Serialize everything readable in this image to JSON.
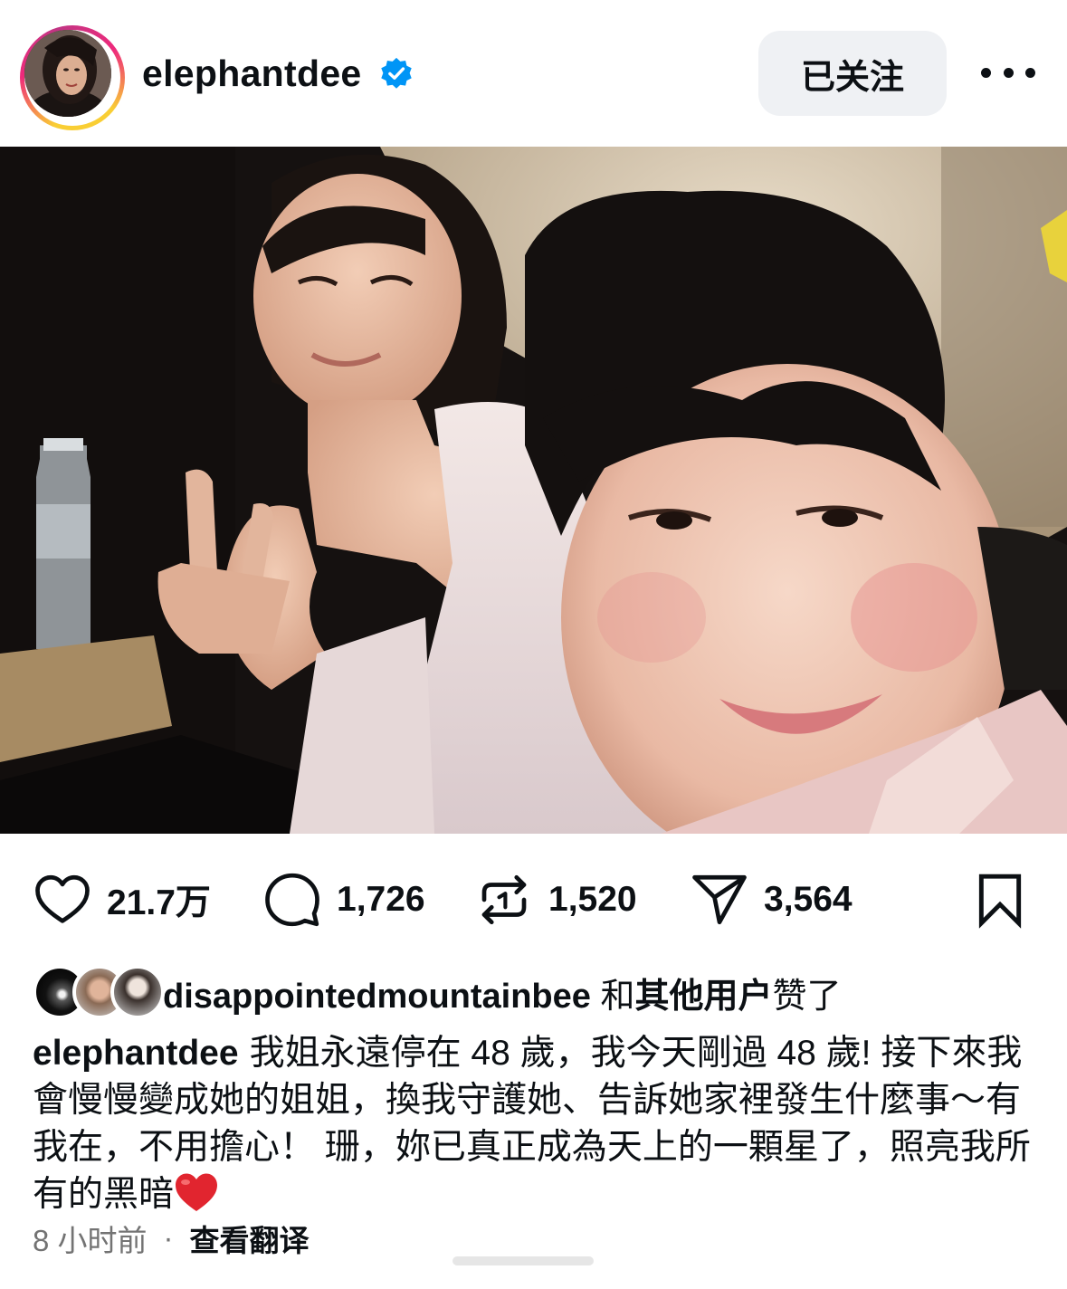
{
  "post": {
    "username": "elephantdee",
    "verified": true,
    "follow_label": "已关注",
    "more_icon": "more-dots-icon"
  },
  "actions": {
    "likes": "21.7万",
    "comments": "1,726",
    "reposts": "1,520",
    "shares": "3,564"
  },
  "liked_by": {
    "user": "disappointedmountainbee",
    "suffix_connector": "和",
    "suffix_bold": "其他用户",
    "suffix_end": "赞了"
  },
  "caption": {
    "username": "elephantdee",
    "text": "我姐永遠停在 48 歲，我今天剛過 48 歲! 接下來我會慢慢變成她的姐姐，換我守護她、告訴她家裡發生什麼事～有我在，不用擔心！ 珊，妳已真正成為天上的一顆星了，照亮我所有的黑暗",
    "emoji": "red-heart"
  },
  "footer": {
    "time": "8 小时前",
    "separator": "·",
    "translate": "查看翻译"
  },
  "colors": {
    "verified_blue": "#0095f6",
    "follow_bg": "#eff1f4",
    "meta_gray": "#737373"
  }
}
